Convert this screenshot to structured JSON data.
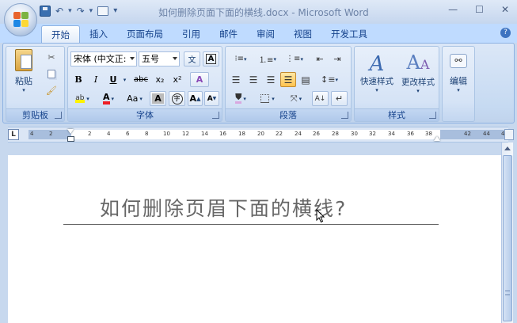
{
  "window": {
    "title": "如何删除页面下面的横线.docx - Microsoft Word",
    "minimize": "—",
    "maximize": "☐",
    "close": "✕"
  },
  "qat": {
    "undo": "↶",
    "redo": "↷",
    "dropdown": "▾"
  },
  "tabs": [
    "开始",
    "插入",
    "页面布局",
    "引用",
    "邮件",
    "审阅",
    "视图",
    "开发工具"
  ],
  "ribbon": {
    "clipboard": {
      "label": "剪贴板",
      "paste": "粘贴"
    },
    "font": {
      "label": "字体",
      "font_name": "宋体 (中文正:",
      "font_size": "五号",
      "bold": "B",
      "italic": "I",
      "underline": "U",
      "strikethrough": "abc",
      "subscript": "x₂",
      "superscript": "x²",
      "change_case": "Aa",
      "font_color": "A",
      "char_shading": "A",
      "enclosed": "字",
      "grow": "A",
      "shrink": "A",
      "clear_format": "A",
      "phonetic": "文"
    },
    "paragraph": {
      "label": "段落"
    },
    "styles": {
      "label": "样式",
      "quick_styles": "快速样式",
      "change_styles": "更改样式"
    },
    "editing": {
      "label": "编辑"
    }
  },
  "ruler": {
    "corner": "L",
    "ticks": [
      "4",
      "2",
      "2",
      "4",
      "6",
      "8",
      "10",
      "12",
      "14",
      "16",
      "18",
      "20",
      "22",
      "24",
      "26",
      "28",
      "30",
      "32",
      "34",
      "36",
      "38",
      "42",
      "44",
      "46"
    ]
  },
  "document": {
    "header_text": "如何删除页眉下面的横线?"
  },
  "colors": {
    "ribbon_bg": "#c6daf2",
    "active_button": "#ffc34e",
    "header_text": "#666666"
  }
}
